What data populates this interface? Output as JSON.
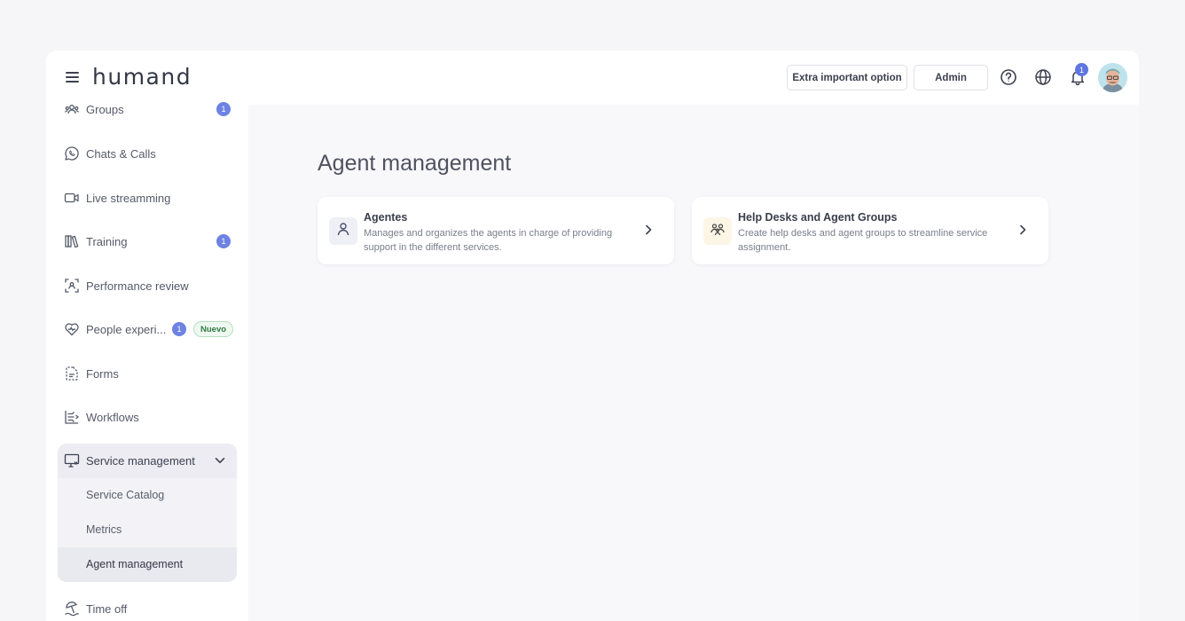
{
  "app": {
    "logo": "humand"
  },
  "header": {
    "extra_button": "Extra important option",
    "admin_button": "Admin",
    "notification_count": "1"
  },
  "sidebar": {
    "items": [
      {
        "label": "Groups",
        "icon": "groups-icon",
        "badge": "1"
      },
      {
        "label": "Chats & Calls",
        "icon": "chat-icon"
      },
      {
        "label": "Live streamming",
        "icon": "video-icon"
      },
      {
        "label": "Training",
        "icon": "books-icon",
        "badge": "1"
      },
      {
        "label": "Performance review",
        "icon": "focus-icon"
      },
      {
        "label": "People experi...",
        "icon": "heart-icon",
        "badge": "1",
        "tag": "Nuevo"
      },
      {
        "label": "Forms",
        "icon": "form-icon"
      },
      {
        "label": "Workflows",
        "icon": "workflow-icon"
      }
    ],
    "service_management": {
      "label": "Service management",
      "icon": "monitor-icon",
      "children": [
        {
          "label": "Service Catalog"
        },
        {
          "label": "Metrics"
        },
        {
          "label": "Agent management",
          "active": true
        }
      ]
    },
    "time_off": {
      "label": "Time off",
      "icon": "beach-icon"
    }
  },
  "main": {
    "title": "Agent management",
    "cards": [
      {
        "title": "Agentes",
        "description": "Manages and organizes the agents in charge of providing support in the different services.",
        "icon": "person-icon",
        "icon_bg": "#eef0f6"
      },
      {
        "title": "Help Desks and Agent Groups",
        "description": "Create help desks and agent groups to streamline service assignment.",
        "icon": "agent-groups-icon",
        "icon_bg": "#fdf6e6"
      }
    ]
  },
  "colors": {
    "accent": "#6d82e3",
    "new_tag": "#2f7a44"
  }
}
